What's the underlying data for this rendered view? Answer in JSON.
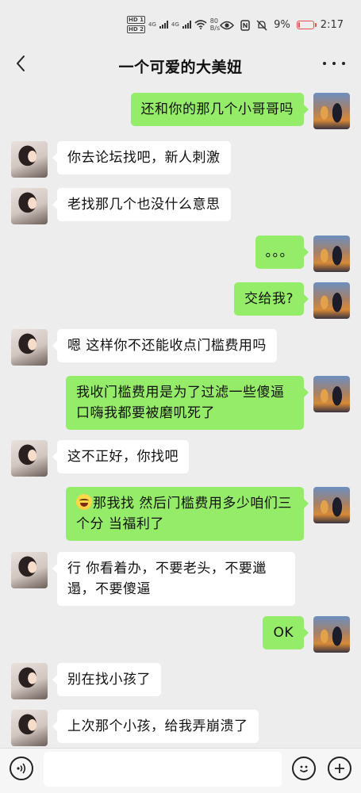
{
  "status_bar": {
    "hd1": "HD 1",
    "hd2": "HD 2",
    "net1": "4G",
    "net2": "4G",
    "speed_value": "80",
    "speed_unit": "B/s",
    "battery": "9%",
    "battery_level": 0.09,
    "time": "2:17"
  },
  "header": {
    "title": "一个可爱的大美妞"
  },
  "messages": [
    {
      "side": "right",
      "text": "还和你的那几个小哥哥吗"
    },
    {
      "side": "left",
      "text": "你去论坛找吧，新人刺激"
    },
    {
      "side": "left",
      "text": "老找那几个也没什么意思"
    },
    {
      "side": "right",
      "text": "。。。"
    },
    {
      "side": "right",
      "text": "交给我?"
    },
    {
      "side": "left",
      "text": "嗯 这样你不还能收点门槛费用吗"
    },
    {
      "side": "right",
      "text": "我收门槛费用是为了过滤一些傻逼口嗨我都要被磨叽死了"
    },
    {
      "side": "left",
      "text": "这不正好，你找吧"
    },
    {
      "side": "right",
      "text": "那我找 然后门槛费用多少咱们三个分 当福利了",
      "emoji": "laughing-emoji"
    },
    {
      "side": "left",
      "text": "行 你看着办，不要老头，不要邋遢，不要傻逼"
    },
    {
      "side": "right",
      "text": "OK"
    },
    {
      "side": "left",
      "text": "别在找小孩了"
    },
    {
      "side": "left",
      "text": "上次那个小孩，给我弄崩溃了"
    }
  ],
  "input": {
    "placeholder": ""
  },
  "colors": {
    "background": "#ededed",
    "bubble_self": "#95ec69",
    "bubble_other": "#ffffff",
    "battery": "#e05050"
  }
}
